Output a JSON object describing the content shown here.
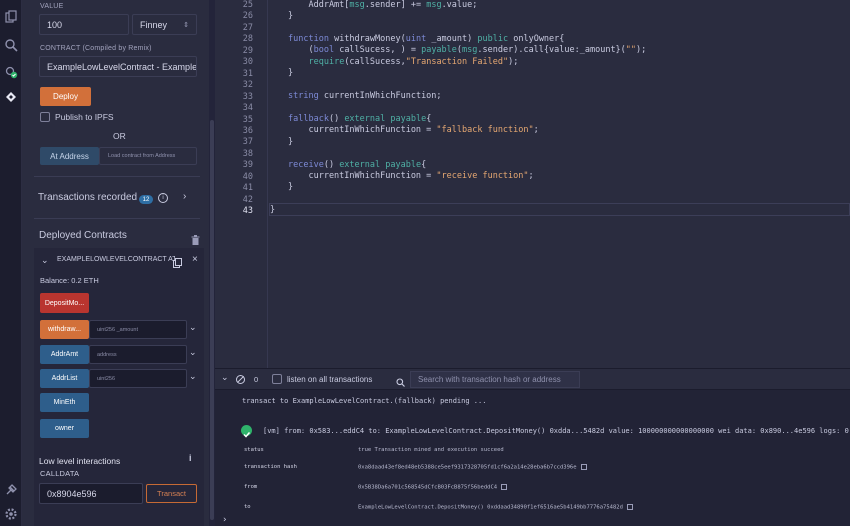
{
  "sidebar": {
    "value_label": "VALUE",
    "value_amount": "100",
    "value_unit": "Finney",
    "contract_label": "CONTRACT (Compiled by Remix)",
    "contract_selected": "ExampleLowLevelContract - Example",
    "deploy_label": "Deploy",
    "publish_label": "Publish to IPFS",
    "or_label": "OR",
    "at_address_label": "At Address",
    "load_contract_label": "Load contract from Address",
    "transactions_recorded_label": "Transactions recorded",
    "transactions_count": "12",
    "deployed_contracts_label": "Deployed Contracts",
    "instance_name": "EXAMPLELOWLEVELCONTRACT AT",
    "balance": "Balance: 0.2 ETH",
    "functions": [
      {
        "label": "DepositMo...",
        "color": "red"
      },
      {
        "label": "withdraw...",
        "color": "orange",
        "placeholder": "uint256 _amount"
      },
      {
        "label": "AddrAmt",
        "color": "blue",
        "placeholder": "address"
      },
      {
        "label": "AddrList",
        "color": "blue",
        "placeholder": "uint256"
      },
      {
        "label": "MinEth",
        "color": "blue"
      },
      {
        "label": "owner",
        "color": "blue"
      }
    ],
    "low_level_label": "Low level interactions",
    "calldata_label": "CALLDATA",
    "calldata_value": "0x8904e596",
    "transact_label": "Transact"
  },
  "editor": {
    "line_numbers": [
      "25",
      "26",
      "27",
      "28",
      "29",
      "30",
      "31",
      "32",
      "33",
      "34",
      "35",
      "36",
      "37",
      "38",
      "39",
      "40",
      "41",
      "42",
      "43"
    ],
    "active_line": "43"
  },
  "terminal": {
    "pending_count": "0",
    "listen_label": "listen on all transactions",
    "search_placeholder": "Search with transaction hash or address",
    "pending_line": "transact to ExampleLowLevelContract.(fallback) pending ...",
    "tx_summary": "[vm]  from: 0x583...eddC4 to: ExampleLowLevelContract.DepositMoney() 0xdda...5482d value: 100000000000000000 wei data: 0x890...4e596 logs: 0",
    "details": [
      {
        "key": "status",
        "value": "true Transaction mined and execution succeed",
        "copy": false
      },
      {
        "key": "transaction hash",
        "value": "0xa8daad43ef8ed48eb5388ce5eef9317328705fd1cf6a2a14e28eba6b7ccd396e",
        "copy": true
      },
      {
        "key": "from",
        "value": "0x5B38Da6a701c568545dCfcB03FcB875f56beddC4",
        "copy": true
      },
      {
        "key": "to",
        "value": "ExampleLowLevelContract.DepositMoney() 0xddaad34890f1ef6516ae5b4149bb7776a75482d",
        "copy": true
      }
    ]
  },
  "colors": {
    "accent_orange": "#d2703a",
    "deposit_red": "#b9352f",
    "call_blue": "#2e5e8b",
    "success_green": "#2fb36b"
  }
}
